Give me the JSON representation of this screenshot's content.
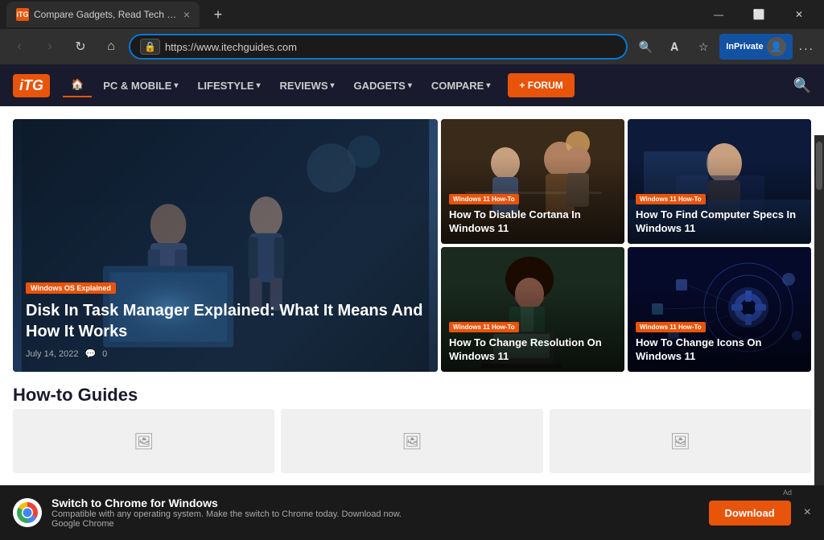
{
  "browser": {
    "tab": {
      "favicon": "iTG",
      "title": "Compare Gadgets, Read Tech G..."
    },
    "address": "https://www.itechguides.com",
    "nav_buttons": {
      "back": "‹",
      "forward": "›",
      "refresh": "↻",
      "home": "⌂"
    },
    "inprivate_label": "InPrivate",
    "more_label": "..."
  },
  "site": {
    "logo": "iTG",
    "nav_items": [
      {
        "label": "🏠",
        "active": true,
        "has_arrow": false
      },
      {
        "label": "PC & MOBILE",
        "active": false,
        "has_arrow": true
      },
      {
        "label": "LIFESTYLE",
        "active": false,
        "has_arrow": true
      },
      {
        "label": "REVIEWS",
        "active": false,
        "has_arrow": true
      },
      {
        "label": "GADGETS",
        "active": false,
        "has_arrow": true
      },
      {
        "label": "COMPARE",
        "active": false,
        "has_arrow": true
      }
    ],
    "forum_button": "+ FORUM"
  },
  "hero": {
    "badge": "Windows OS Explained",
    "title": "Disk In Task Manager Explained: What It Means And How It Works",
    "date": "July 14, 2022",
    "comments": "0"
  },
  "cards": [
    {
      "badge": "Windows 11 How-To",
      "title": "How To Disable Cortana In Windows 11",
      "bg": "meeting"
    },
    {
      "badge": "Windows 11 How-To",
      "title": "How To Find Computer Specs In Windows 11",
      "bg": "blue-tech"
    },
    {
      "badge": "Windows 11 How-To",
      "title": "How To Change Resolution On Windows 11",
      "bg": "lady-laptop"
    },
    {
      "badge": "Windows 11 How-To",
      "title": "How To Change Icons On Windows 11",
      "bg": "dark-tech"
    }
  ],
  "howto_section": {
    "title": "How-to Guides"
  },
  "ad": {
    "title": "Switch to Chrome for Windows",
    "description": "Compatible with any operating system. Make the switch to Chrome today. Download now.",
    "brand": "Google Chrome",
    "download_label": "Download",
    "close": "×",
    "ad_label": "Ad"
  }
}
